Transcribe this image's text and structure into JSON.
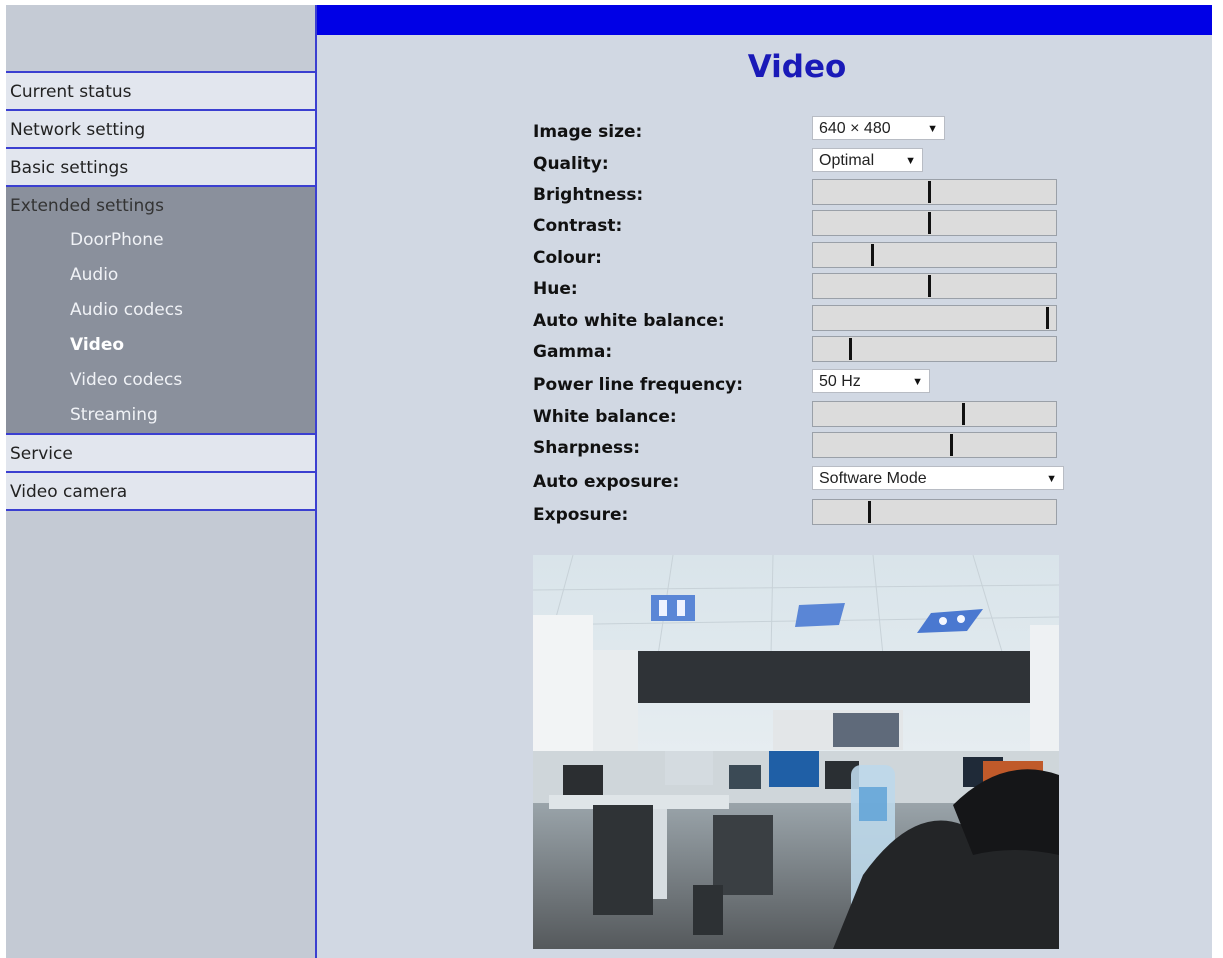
{
  "nav": {
    "current_status": "Current status",
    "network_setting": "Network setting",
    "basic_settings": "Basic settings",
    "extended_settings": {
      "label": "Extended settings",
      "items": [
        {
          "label": "DoorPhone"
        },
        {
          "label": "Audio"
        },
        {
          "label": "Audio codecs"
        },
        {
          "label": "Video",
          "active": true
        },
        {
          "label": "Video codecs"
        },
        {
          "label": "Streaming"
        }
      ]
    },
    "service": "Service",
    "video_camera": "Video camera"
  },
  "page": {
    "title": "Video"
  },
  "settings": {
    "image_size": {
      "label": "Image size:",
      "value": "640 × 480"
    },
    "quality": {
      "label": "Quality:",
      "value": "Optimal"
    },
    "brightness": {
      "label": "Brightness:",
      "level": 0.48
    },
    "contrast": {
      "label": "Contrast:",
      "level": 0.48
    },
    "colour": {
      "label": "Colour:",
      "level": 0.24
    },
    "hue": {
      "label": "Hue:",
      "level": 0.48
    },
    "auto_white_balance": {
      "label": "Auto white balance:",
      "level": 0.97
    },
    "gamma": {
      "label": "Gamma:",
      "level": 0.15
    },
    "power_line_frequency": {
      "label": "Power line frequency:",
      "value": "50 Hz"
    },
    "white_balance": {
      "label": "White balance:",
      "level": 0.62
    },
    "sharpness": {
      "label": "Sharpness:",
      "level": 0.57
    },
    "auto_exposure": {
      "label": "Auto exposure:",
      "value": "Software Mode"
    },
    "exposure": {
      "label": "Exposure:",
      "level": 0.23
    }
  },
  "colors": {
    "top_bar": "#0000e6",
    "accent_line": "#3b3fd0",
    "title": "#1a1ab8",
    "main_bg": "#d1d8e3"
  }
}
